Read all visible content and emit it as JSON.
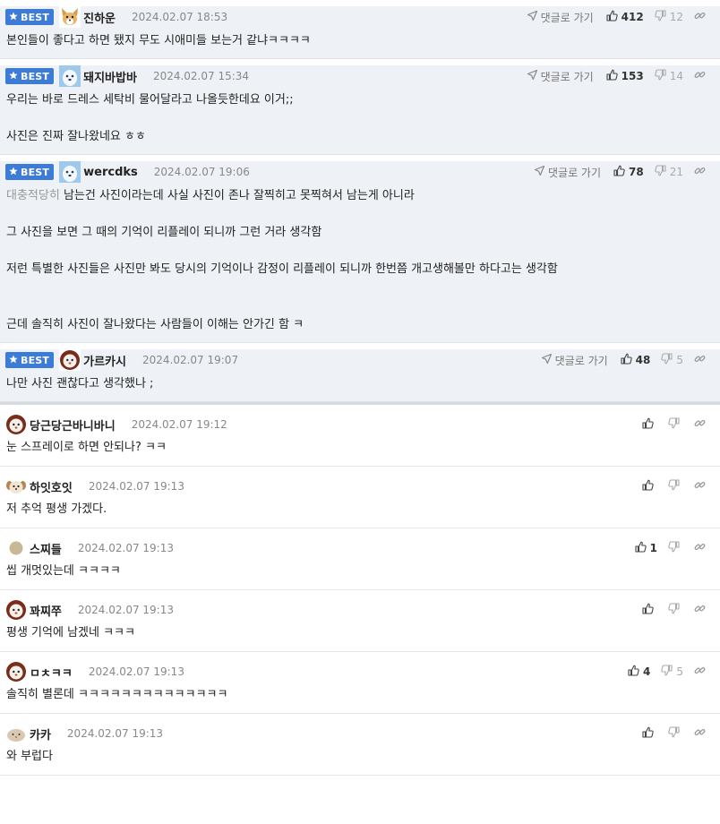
{
  "best_label": "BEST",
  "reply_label": "댓글로 가기",
  "best_comments": [
    {
      "nick": "진하운",
      "date": "2024.02.07 18:53",
      "likes": "412",
      "dislikes": "12",
      "avatar": "dog-face-avatar",
      "lines": [
        "본인들이 좋다고 하면 됐지 무도 시애미들 보는거 같냐ㅋㅋㅋㅋ"
      ]
    },
    {
      "nick": "돼지바밥바",
      "date": "2024.02.07 15:34",
      "likes": "153",
      "dislikes": "14",
      "avatar": "blue-pet-avatar",
      "lines": [
        "우리는 바로 드레스 세탁비 물어달라고 나올듯한데요 이거;;",
        "",
        "사진은 진짜 잘나왔네요 ㅎㅎ"
      ]
    },
    {
      "nick": "wercdks",
      "date": "2024.02.07 19:06",
      "likes": "78",
      "dislikes": "21",
      "avatar": "blue-pet-avatar",
      "quote": "대충적당히",
      "lines": [
        "남는건 사진이라는데 사실 사진이 존나 잘찍히고 못찍혀서 남는게 아니라",
        "",
        "그 사진을 보면 그 때의 기억이 리플레이 되니까 그런 거라 생각함",
        "",
        "저런 특별한 사진들은 사진만 봐도 당시의 기억이나 감정이 리플레이 되니까 한번쯤 개고생해볼만 하다고는 생각함",
        "",
        "",
        "근데 솔직히 사진이 잘나왔다는 사람들이 이해는 안가긴 함 ㅋ"
      ]
    },
    {
      "nick": "가르카시",
      "date": "2024.02.07 19:07",
      "likes": "48",
      "dislikes": "5",
      "avatar": "lion-avatar",
      "lines": [
        "나만 사진 괜찮다고 생각했나 ;"
      ]
    }
  ],
  "comments": [
    {
      "nick": "당근당근바니바니",
      "date": "2024.02.07 19:12",
      "likes": "",
      "dislikes": "",
      "avatar": "lion-avatar",
      "lines": [
        "눈 스프레이로 하면 안되나? ㅋㅋ"
      ]
    },
    {
      "nick": "하잇호잇",
      "date": "2024.02.07 19:13",
      "likes": "",
      "dislikes": "",
      "avatar": "puppy-avatar",
      "lines": [
        "저 추억 평생 가겠다."
      ]
    },
    {
      "nick": "스찌들",
      "date": "2024.02.07 19:13",
      "likes": "1",
      "dislikes": "",
      "avatar": "circle-avatar",
      "lines": [
        "씹 개멋있는데 ㅋㅋㅋㅋ"
      ]
    },
    {
      "nick": "꽈찌쭈",
      "date": "2024.02.07 19:13",
      "likes": "",
      "dislikes": "",
      "avatar": "lion-avatar",
      "lines": [
        "평생 기억에 남겠네 ㅋㅋㅋ"
      ]
    },
    {
      "nick": "ㅁㅊㅋㅋ",
      "date": "2024.02.07 19:13",
      "likes": "4",
      "dislikes": "5",
      "avatar": "lion-avatar",
      "lines": [
        "솔직히 별론데 ㅋㅋㅋㅋㅋㅋㅋㅋㅋㅋㅋㅋㅋㅋ"
      ]
    },
    {
      "nick": "카카",
      "date": "2024.02.07 19:13",
      "likes": "",
      "dislikes": "",
      "avatar": "hamster-avatar",
      "lines": [
        "와 부럽다"
      ]
    }
  ]
}
